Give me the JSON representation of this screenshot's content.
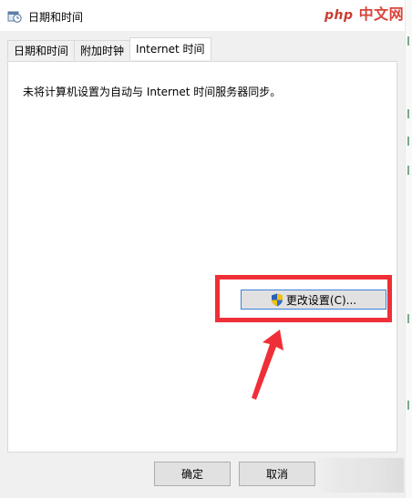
{
  "window": {
    "title": "日期和时间"
  },
  "watermark": {
    "php": "php",
    "site": "中文网"
  },
  "tabs": [
    {
      "label": "日期和时间",
      "active": false
    },
    {
      "label": "附加时钟",
      "active": false
    },
    {
      "label": "Internet 时间",
      "active": true
    }
  ],
  "panel": {
    "message": "未将计算机设置为自动与 Internet 时间服务器同步。",
    "change_settings_label": "更改设置(C)..."
  },
  "footer": {
    "ok_label": "确定",
    "cancel_label": "取消"
  },
  "icons": {
    "title": "clock-calendar-icon",
    "change_settings": "uac-shield-icon"
  },
  "colors": {
    "highlight": "#ef2f37",
    "button_focus_border": "#3c7fd6"
  }
}
